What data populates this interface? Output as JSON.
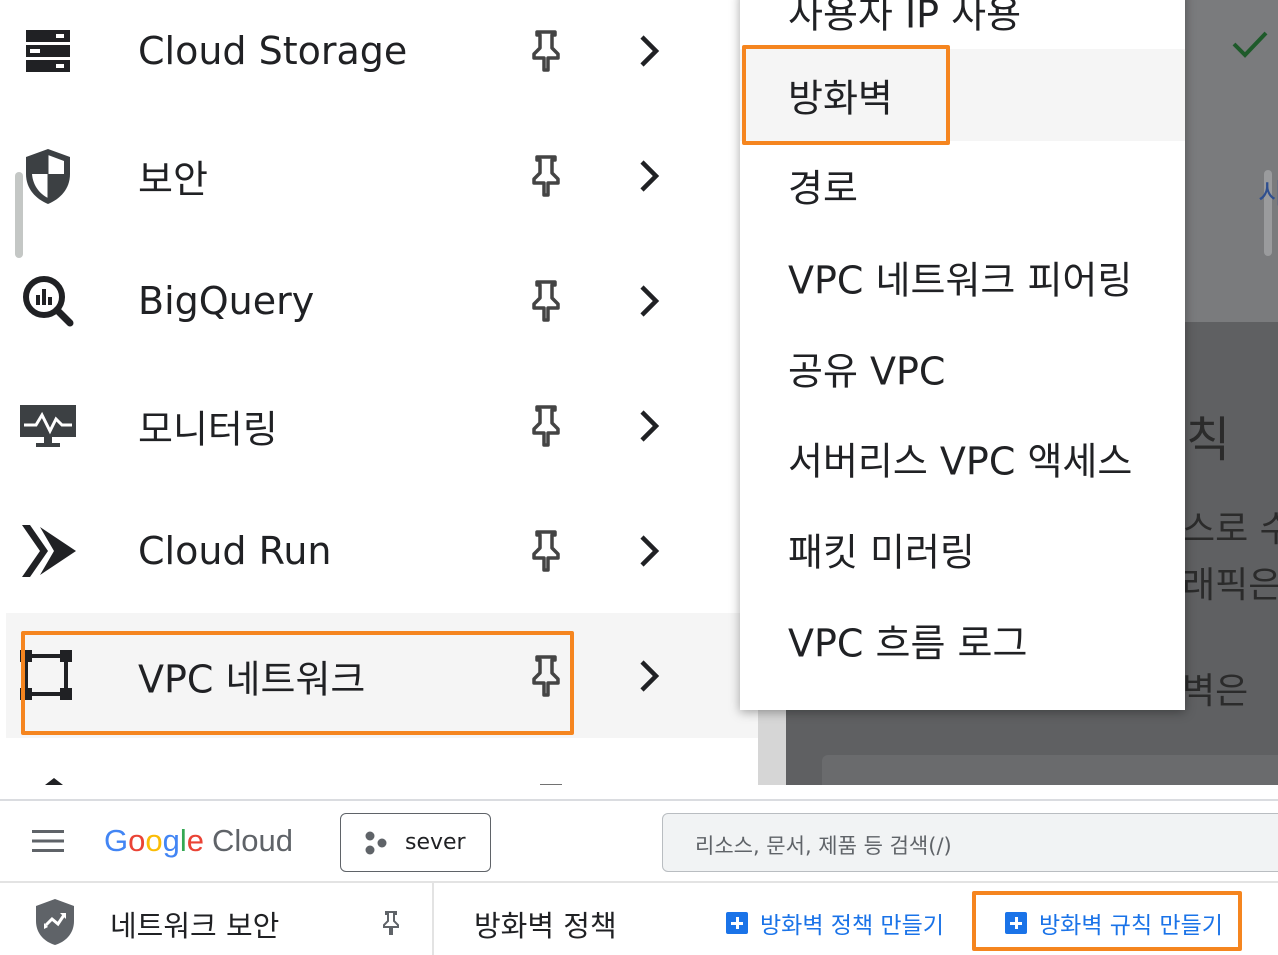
{
  "nav": {
    "items": [
      {
        "label": "Cloud Storage",
        "icon": "storage-icon"
      },
      {
        "label": "보안",
        "icon": "security-shield-icon"
      },
      {
        "label": "BigQuery",
        "icon": "bigquery-icon"
      },
      {
        "label": "모니터링",
        "icon": "monitoring-icon"
      },
      {
        "label": "Cloud Run",
        "icon": "cloud-run-icon"
      },
      {
        "label": "VPC 네트워크",
        "icon": "vpc-network-icon"
      }
    ]
  },
  "submenu": {
    "items": [
      {
        "label": "사용자 IP 사용"
      },
      {
        "label": "방화벽"
      },
      {
        "label": "경로"
      },
      {
        "label": "VPC 네트워크 피어링"
      },
      {
        "label": "공유 VPC"
      },
      {
        "label": "서버리스 VPC 액세스"
      },
      {
        "label": "패킷 미러링"
      },
      {
        "label": "VPC 흐름 로그"
      }
    ]
  },
  "background": {
    "fragments": [
      "칙",
      "스로 수",
      "래픽은",
      "벽은",
      "시"
    ]
  },
  "header": {
    "logo_google": [
      "G",
      "o",
      "o",
      "g",
      "l",
      "e"
    ],
    "logo_cloud": "Cloud",
    "project_name": "sever",
    "search_placeholder": "리소스, 문서, 제품 등 검색(/)"
  },
  "subheader": {
    "section_title": "네트워크 보안",
    "page_title": "방화벽 정책",
    "create_policy_label": "방화벽 정책 만들기",
    "create_rule_label": "방화벽 규칙 만들기"
  },
  "colors": {
    "highlight": "#f5851f",
    "link_blue": "#1a73e8",
    "hover_bg": "#f5f5f5"
  }
}
